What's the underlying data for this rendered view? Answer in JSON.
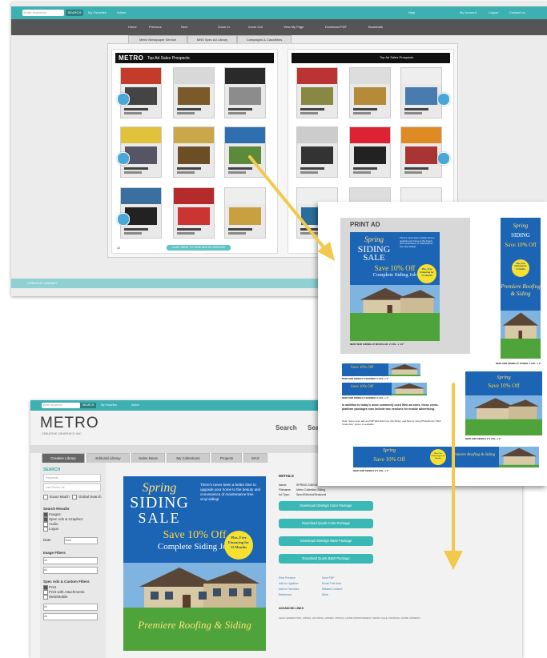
{
  "screenA": {
    "topbar": {
      "search_placeholder": "Enter keywords",
      "go": "SEARCH",
      "links": [
        "My Favorites",
        "Admin",
        "Help",
        "My Account",
        "Logout",
        "Contact Us"
      ]
    },
    "toolbar": [
      "Home",
      "Previous",
      "Next",
      "Zoom In",
      "Zoom Out",
      "View My Page",
      "Download PDF",
      "Bookmark"
    ],
    "tabs": [
      "Metro Newspaper Service",
      "MNS Spec Ad Library",
      "Campaigns & Classifieds"
    ],
    "left_page": {
      "brand": "METRO",
      "title": "Top Ad Sales Prospects"
    },
    "right_page": {
      "title": "Top Ad Sales Prospects"
    },
    "library_button": "CLICK HERE TO VIEW ADS IN CREATIVE LIBRARY",
    "page_number": "10",
    "bottom_bar": "CREATIVE LIBRARY"
  },
  "screenB": {
    "topbar": {
      "search_placeholder": "Enter keywords",
      "go": "SEARCH",
      "links": [
        "My Favorites",
        "Admin"
      ]
    },
    "logo": {
      "main": "METRO",
      "sub": "CREATIVE GRAPHICS INC."
    },
    "nav": [
      "Search",
      "Search"
    ],
    "tabs": [
      "Creative Library",
      "Editorial Library",
      "Sales News",
      "My Collections",
      "Projects",
      "MAX"
    ],
    "sidebar": {
      "search_heading": "SEARCH",
      "keyword_placeholder": "Keywords",
      "last_period": "Last Period: All",
      "checkbox_labels": [
        "Exact Match",
        "Global Search"
      ],
      "results_heading": "Search Results",
      "result_options": [
        "Images",
        "Spec Ads & Graphics",
        "Audio",
        "Logos"
      ],
      "image_filters_heading": "Image Filters",
      "image_type": "All",
      "image_format": "All",
      "spec_heading": "Spec Ads & Custom Filters",
      "spec_options": [
        "Print",
        "Print with Attachments",
        "Web/Mobile"
      ],
      "print_ad_size": "All",
      "print_ad_type": "All",
      "date_label": "Date",
      "date_value": "None"
    },
    "details": {
      "heading": "DETAILS",
      "meta": [
        {
          "k": "Name:",
          "v": "SPRING SIDING SALE"
        },
        {
          "k": "Filename:",
          "v": "Metro Collection Siding"
        },
        {
          "k": "Ad Type:",
          "v": "Spec/Editorial/Seasonal"
        }
      ],
      "buttons": [
        "Download InDesign Color Package",
        "Download Quark Color Package",
        "Download InDesign B&W Package",
        "Download Quark B&W Package"
      ],
      "links": [
        "Print Preview",
        "View PDF",
        "Add to Lightbox",
        "Email This Item",
        "Add to Favorites",
        "Related Content",
        "Reference",
        "More"
      ],
      "advanced_heading": "ADVANCED LINKS",
      "advanced_links": "LEAD GENERATION, SIDING, HOUSING, HOMES, SPRING, HOME IMPROVEMENT, SIDING SALE, ROOFING, HOME OWNERS"
    }
  },
  "screenC": {
    "heading": "PRINT AD",
    "main_caption": "NEW! MJR SIDING1-P MODULAR: 2 COL. x 4.5\"",
    "tower_caption": "NEW! MJR SIDING1-P TOWER: 1 COL. x 9\"",
    "strip1_caption": "NEW! MJR SIDING1-P BANNER: 5 COL. x 1\"",
    "strip2_caption": "NEW! MJR SIDING1-P BANNER: 3 COL. x 1\"",
    "side_caption": "NEW! MJR SIDING1-P 3 COL. x 4\"",
    "bottom_caption": "NEW! MJR SIDING1-P 5 COL. x 1\"",
    "note": "In addition to today's most commonly used Web ad sizes, these cross-platform packages now include two versions for mobile advertising.",
    "note2": "Note: Some spec ads and MP Web ads from this library, and files by using Photoshop's \"Web Smart Ads\" option is available."
  },
  "ad": {
    "spring": "Spring",
    "siding": "SIDING",
    "sale": "SALE",
    "save": "Save 10% Off",
    "complete": "Complete Siding Job",
    "badge": "Plus, Free Financing for 12 Months",
    "premiere": "Premiere Roofing & Siding",
    "copy": "There's never been a better time to upgrade your home to the beauty and convenience of maintenance-free vinyl siding!"
  },
  "colors": {
    "teal": "#3fb0b2",
    "ad_blue": "#1c64b4",
    "badge_yellow": "#f7e12e",
    "arrow": "#f2c94c"
  }
}
